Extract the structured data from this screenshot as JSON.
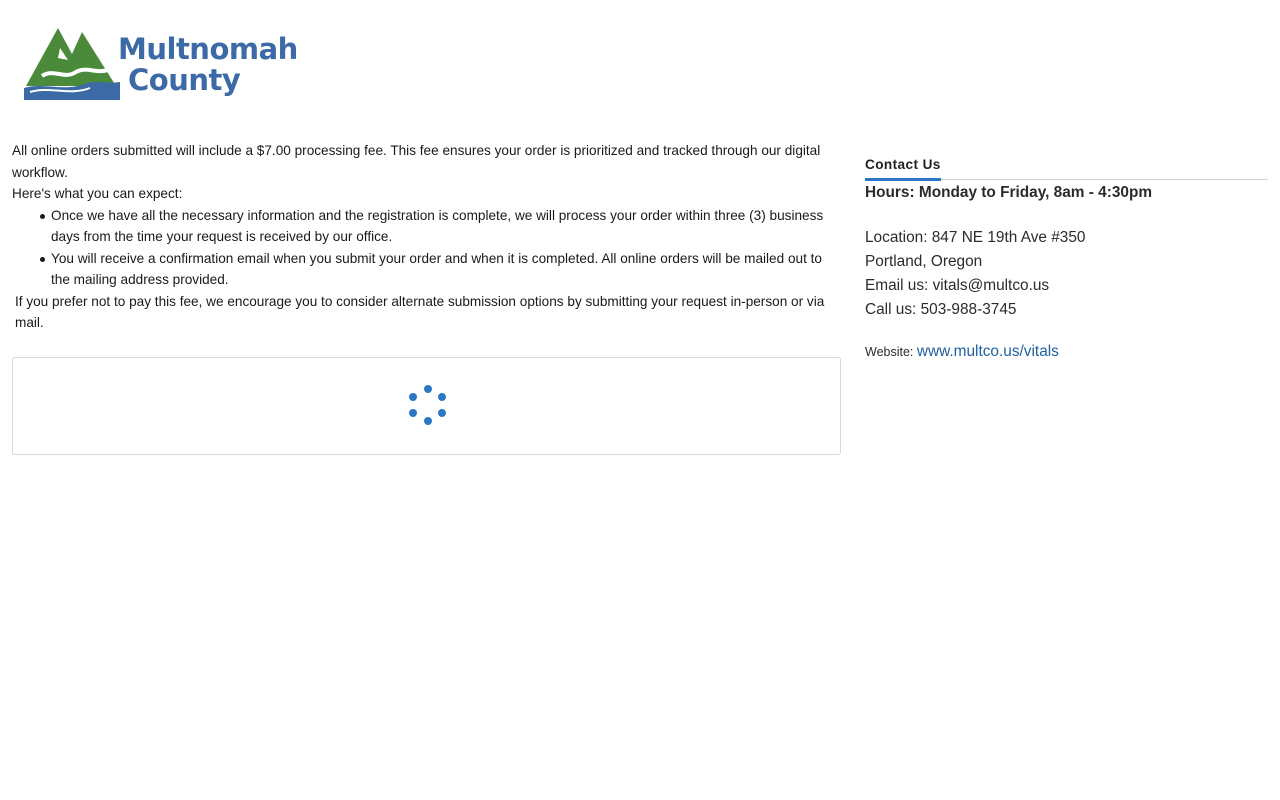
{
  "brand": {
    "name_line1": "Multnomah",
    "name_line2": "County",
    "colors": {
      "text": "#3b6aa7",
      "mountain": "#4a8a3a",
      "water": "#3b6aa7"
    }
  },
  "main": {
    "intro": "All online orders submitted will include a $7.00 processing fee. This fee ensures your order is prioritized and tracked through our digital workflow.",
    "expect_label": "Here's what you can expect:",
    "bullets": [
      "Once we have all the necessary information and the registration is complete, we will process your order within three (3) business days from the time your request is received by our office.",
      "You will receive a confirmation email when you submit your order and when it is completed. All online orders will be mailed out to the mailing address provided."
    ],
    "alternate": "If you prefer not to pay this fee, we encourage you to consider alternate submission options by submitting your request in-person or via mail."
  },
  "loader": {
    "icon": "loading-spinner-icon",
    "color": "#2b77c4"
  },
  "sidebar": {
    "contact_tab": "Contact Us",
    "hours": "Hours: Monday to Friday, 8am - 4:30pm",
    "location": "Location: 847 NE 19th Ave #350",
    "city": "Portland, Oregon",
    "email": "Email us: vitals@multco.us",
    "phone": "Call us: 503-988-3745",
    "website_label": "Website:",
    "website_link": "www.multco.us/vitals"
  }
}
